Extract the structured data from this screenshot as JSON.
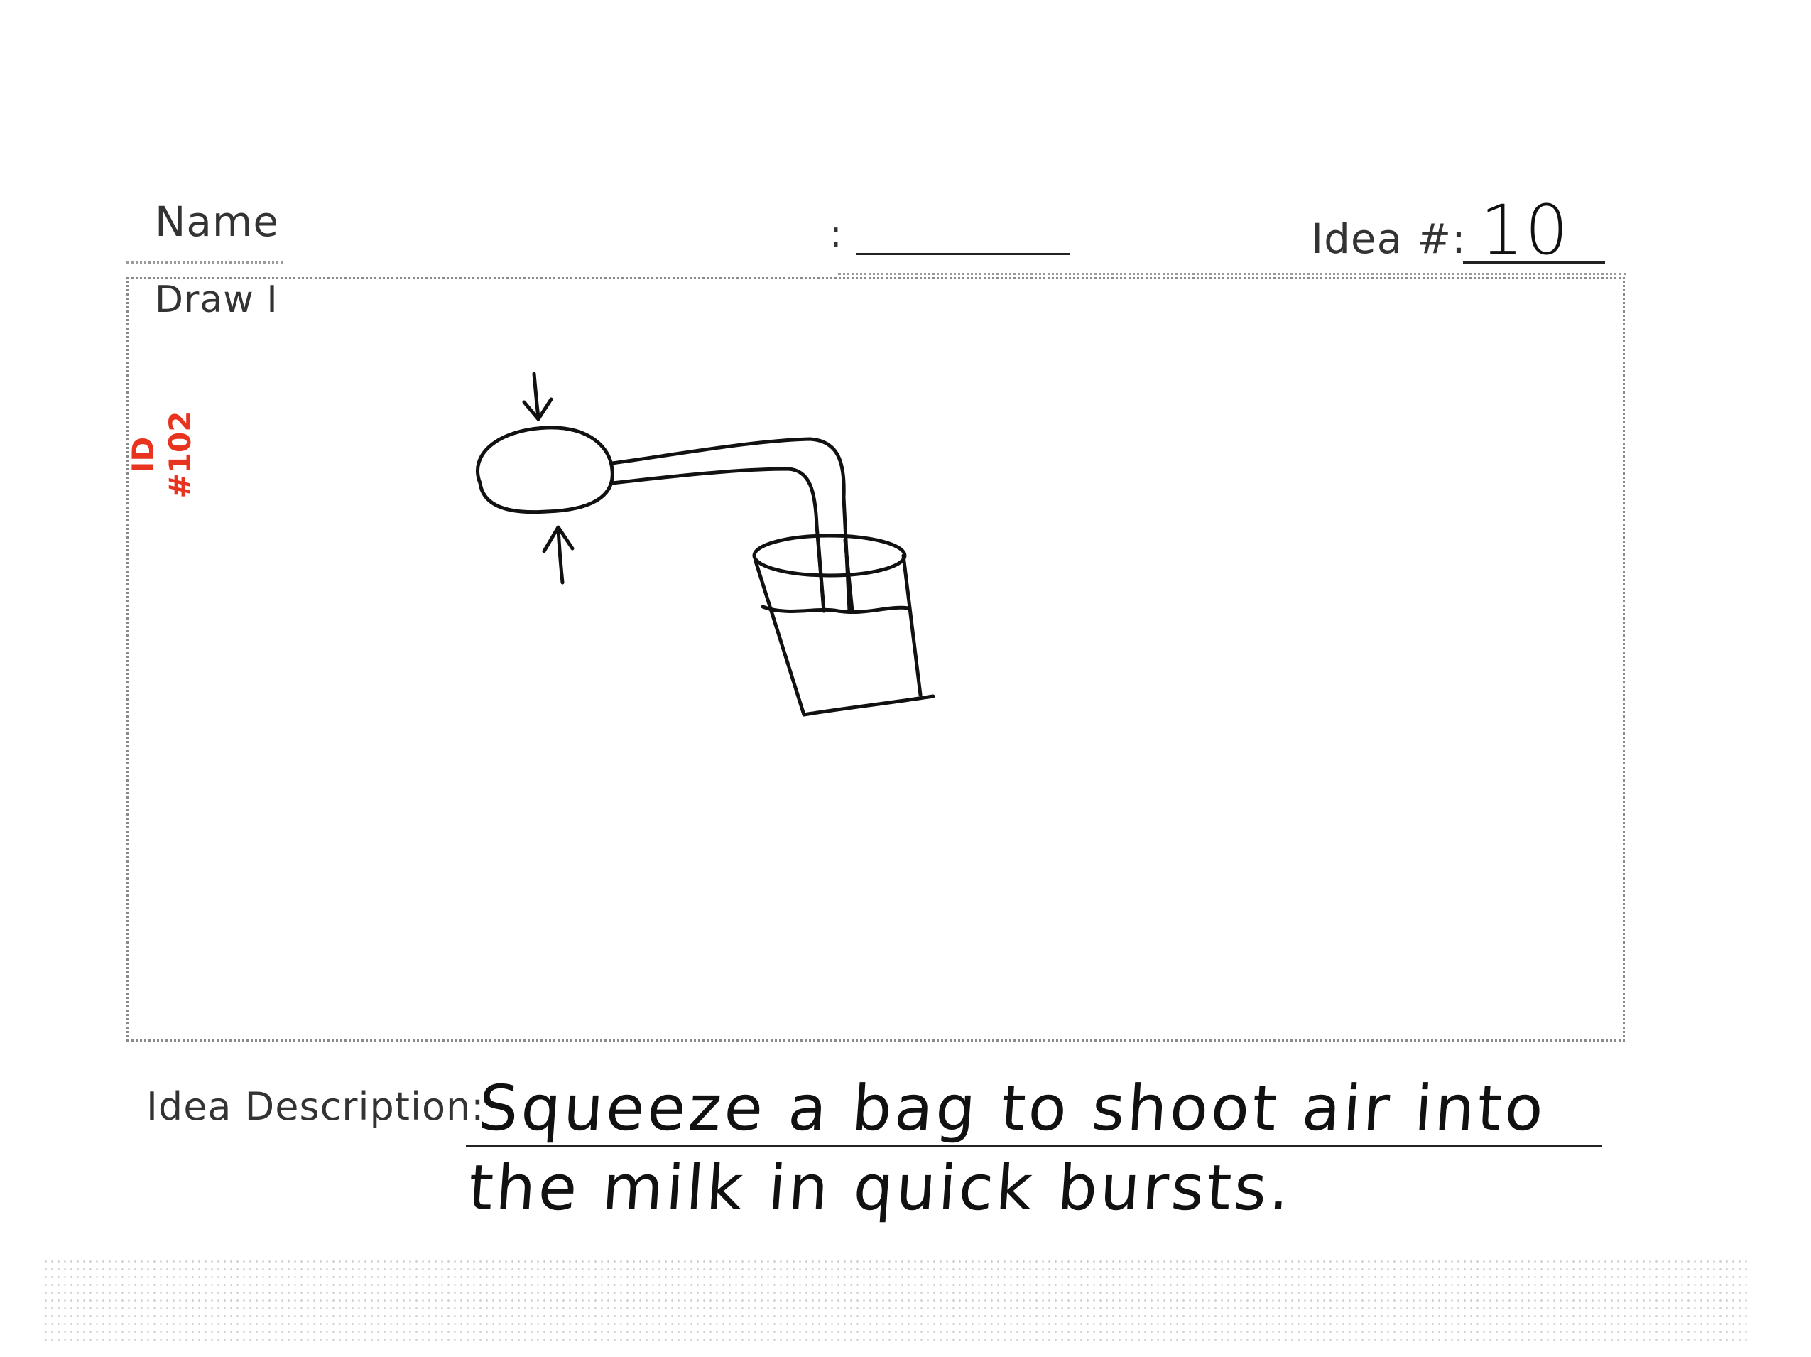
{
  "form": {
    "name_label": "Name",
    "draw_label": "Draw I",
    "colon": ":",
    "idea_number_label": "Idea #:",
    "idea_number_value": "10",
    "idea_description_label": "Idea Description:"
  },
  "stamp": {
    "line1": "ID",
    "line2": "#102"
  },
  "description": {
    "line1": "Squeeze a bag to shoot air into",
    "line2": "the milk in quick bursts."
  },
  "colors": {
    "stamp": "#e8331f",
    "ink": "#111111",
    "print": "#333333"
  },
  "icons": [
    "squeeze-bag-icon",
    "straw-tube-icon",
    "milk-glass-icon",
    "press-arrow-icon"
  ]
}
